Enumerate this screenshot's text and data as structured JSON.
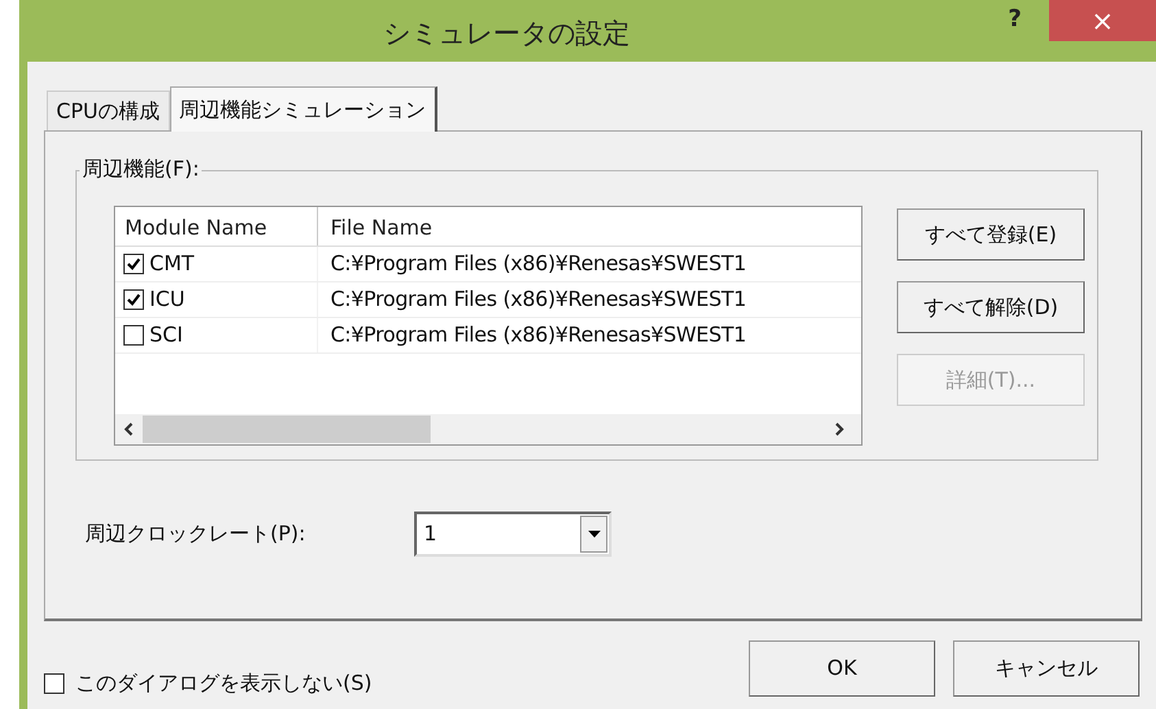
{
  "window": {
    "title": "シミュレータの設定",
    "help": "?",
    "close": "×"
  },
  "tabs": [
    {
      "label": "CPUの構成",
      "selected": false
    },
    {
      "label": "周辺機能シミュレーション",
      "selected": true
    }
  ],
  "group": {
    "label": "周辺機能(F):",
    "table": {
      "columns": [
        "Module Name",
        "File Name"
      ],
      "rows": [
        {
          "module": "CMT",
          "checked": true,
          "file": "C:¥Program Files (x86)¥Renesas¥SWEST1"
        },
        {
          "module": "ICU",
          "checked": true,
          "file": "C:¥Program Files (x86)¥Renesas¥SWEST1"
        },
        {
          "module": "SCI",
          "checked": false,
          "file": "C:¥Program Files (x86)¥Renesas¥SWEST1"
        }
      ]
    },
    "buttons": [
      {
        "label": "すべて登録(E)",
        "disabled": false
      },
      {
        "label": "すべて解除(D)",
        "disabled": false
      },
      {
        "label": "詳細(T)...",
        "disabled": true
      }
    ]
  },
  "clock_rate": {
    "label": "周辺クロックレート(P):",
    "value": "1"
  },
  "dont_show": {
    "label": "このダイアログを表示しない(S)",
    "checked": false
  },
  "footer_buttons": [
    "OK",
    "キャンセル"
  ]
}
